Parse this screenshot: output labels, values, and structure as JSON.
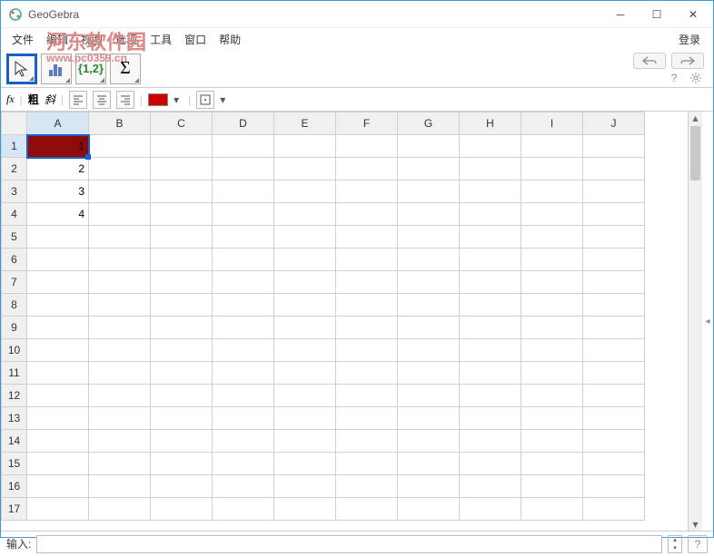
{
  "window": {
    "title": "GeoGebra",
    "login": "登录"
  },
  "watermark": {
    "main": "河东软件园",
    "sub": "www.pc0359.cn"
  },
  "menu": {
    "file": "文件",
    "edit": "编辑",
    "view": "视图",
    "options": "选项",
    "tools": "工具",
    "window": "窗口",
    "help": "帮助"
  },
  "toolbar": {
    "move": "移动",
    "chart": "图表",
    "list": "{1,2}",
    "sum": "Σ"
  },
  "formatbar": {
    "fx": "fx",
    "bold": "粗",
    "italic": "斜"
  },
  "chart_data": {
    "type": "table",
    "columns": [
      "A",
      "B",
      "C",
      "D",
      "E",
      "F",
      "G",
      "H",
      "I",
      "J"
    ],
    "rows": [
      1,
      2,
      3,
      4,
      5,
      6,
      7,
      8,
      9,
      10,
      11,
      12,
      13,
      14,
      15,
      16,
      17
    ],
    "cells": {
      "A1": "1",
      "A2": "2",
      "A3": "3",
      "A4": "4"
    },
    "selected": "A1"
  },
  "inputbar": {
    "label": "输入:"
  }
}
